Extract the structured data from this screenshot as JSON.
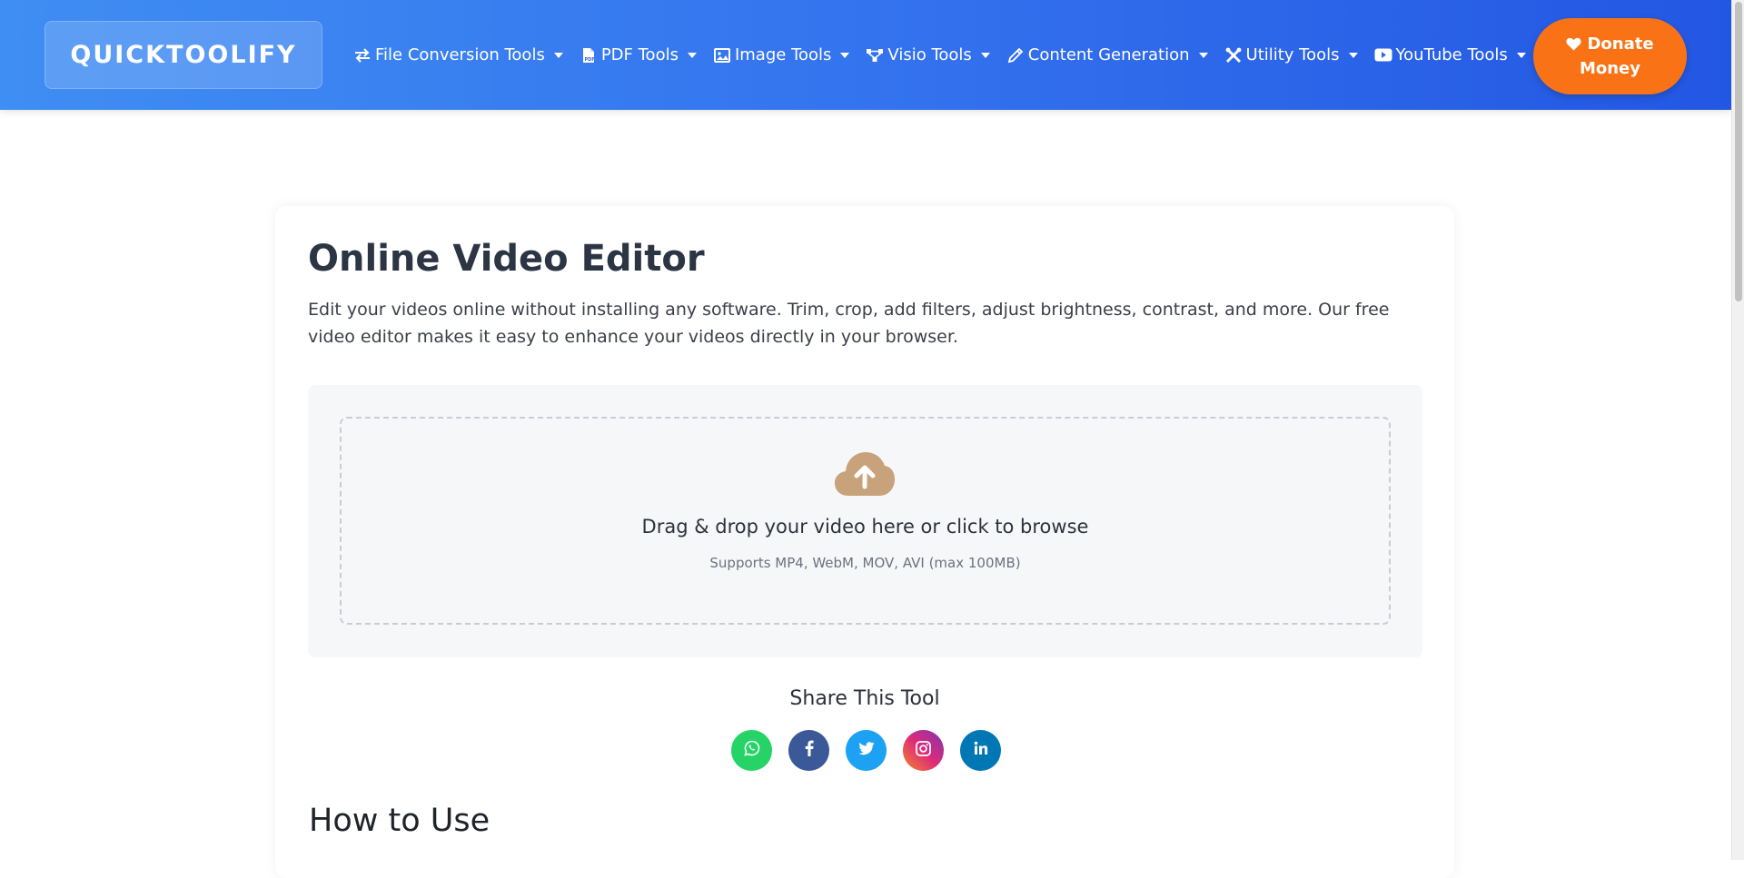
{
  "brand": {
    "name": "QUICKTOOLIFY"
  },
  "nav": {
    "items": [
      {
        "label": "File Conversion Tools",
        "icon": "exchange-arrows-icon"
      },
      {
        "label": "PDF Tools",
        "icon": "pdf-file-icon"
      },
      {
        "label": "Image Tools",
        "icon": "image-icon"
      },
      {
        "label": "Visio Tools",
        "icon": "diagram-nodes-icon"
      },
      {
        "label": "Content Generation",
        "icon": "pencil-icon"
      },
      {
        "label": "Utility Tools",
        "icon": "tools-icon"
      },
      {
        "label": "YouTube Tools",
        "icon": "youtube-icon"
      }
    ],
    "donate": {
      "line1": "Donate",
      "line2": "Money",
      "icon": "heart-icon",
      "color": "#f97316"
    }
  },
  "main": {
    "title": "Online Video Editor",
    "description": "Edit your videos online without installing any software. Trim, crop, add filters, adjust brightness, contrast, and more. Our free video editor makes it easy to enhance your videos directly in your browser.",
    "upload": {
      "icon": "cloud-upload-icon",
      "title": "Drag & drop your video here or click to browse",
      "subtitle": "Supports MP4, WebM, MOV, AVI (max 100MB)"
    },
    "share": {
      "title": "Share This Tool",
      "buttons": [
        {
          "name": "whatsapp",
          "icon": "whatsapp-icon",
          "color": "#25d366"
        },
        {
          "name": "facebook",
          "icon": "facebook-icon",
          "color": "#3b5998"
        },
        {
          "name": "twitter",
          "icon": "twitter-icon",
          "color": "#1da1f2"
        },
        {
          "name": "instagram",
          "icon": "instagram-icon",
          "color": "#c13584"
        },
        {
          "name": "linkedin",
          "icon": "linkedin-icon",
          "color": "#0077b5"
        }
      ]
    },
    "how_to_title": "How to Use"
  },
  "colors": {
    "navbar_start": "#3f8ef3",
    "navbar_end": "#2357e3",
    "upload_icon": "#c8a27a"
  }
}
